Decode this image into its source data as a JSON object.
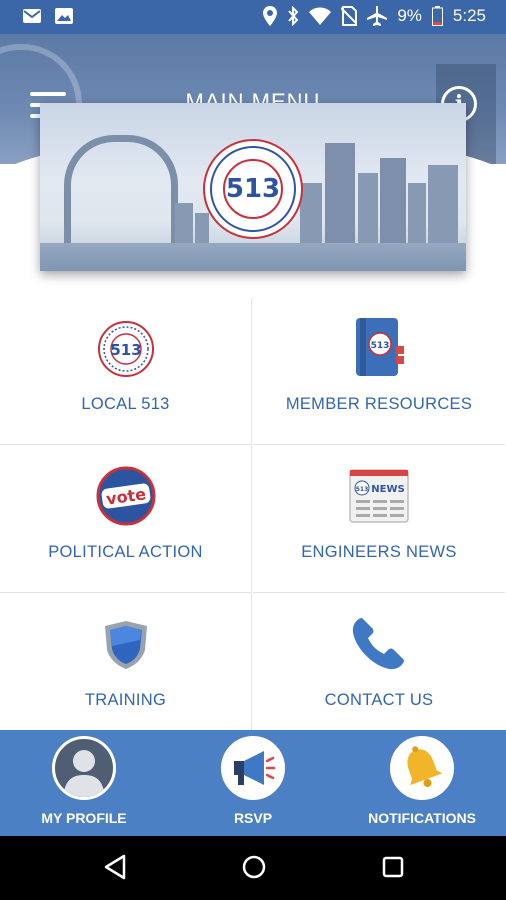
{
  "status_bar": {
    "battery": "9%",
    "time": "5:25",
    "icons": [
      "gmail-icon",
      "photo-icon",
      "location-icon",
      "bluetooth-icon",
      "wifi-icon",
      "no-sim-icon",
      "airplane-icon",
      "battery-icon"
    ]
  },
  "header": {
    "title": "MAIN MENU",
    "menu_icon": "hamburger-icon",
    "info_icon": "info-icon"
  },
  "banner": {
    "seal_text": "513"
  },
  "menu_items": [
    {
      "label": "LOCAL 513",
      "icon": "local-513-seal-icon"
    },
    {
      "label": "MEMBER RESOURCES",
      "icon": "book-icon"
    },
    {
      "label": "POLITICAL ACTION",
      "icon": "vote-icon",
      "icon_text": "vote"
    },
    {
      "label": "ENGINEERS NEWS",
      "icon": "newspaper-icon",
      "icon_text": "NEWS"
    },
    {
      "label": "TRAINING",
      "icon": "shield-icon"
    },
    {
      "label": "CONTACT US",
      "icon": "phone-icon"
    }
  ],
  "bottom_tabs": [
    {
      "label": "MY PROFILE",
      "icon": "profile-icon"
    },
    {
      "label": "RSVP",
      "icon": "megaphone-icon"
    },
    {
      "label": "NOTIFICATIONS",
      "icon": "bell-icon"
    }
  ],
  "nav_bar": [
    "back-icon",
    "home-icon",
    "recents-icon"
  ],
  "colors": {
    "status_bar": "#3b67a8",
    "accent_text": "#3265b1",
    "bottom_bar": "#4b80c4",
    "header": "#6e8ab3"
  }
}
